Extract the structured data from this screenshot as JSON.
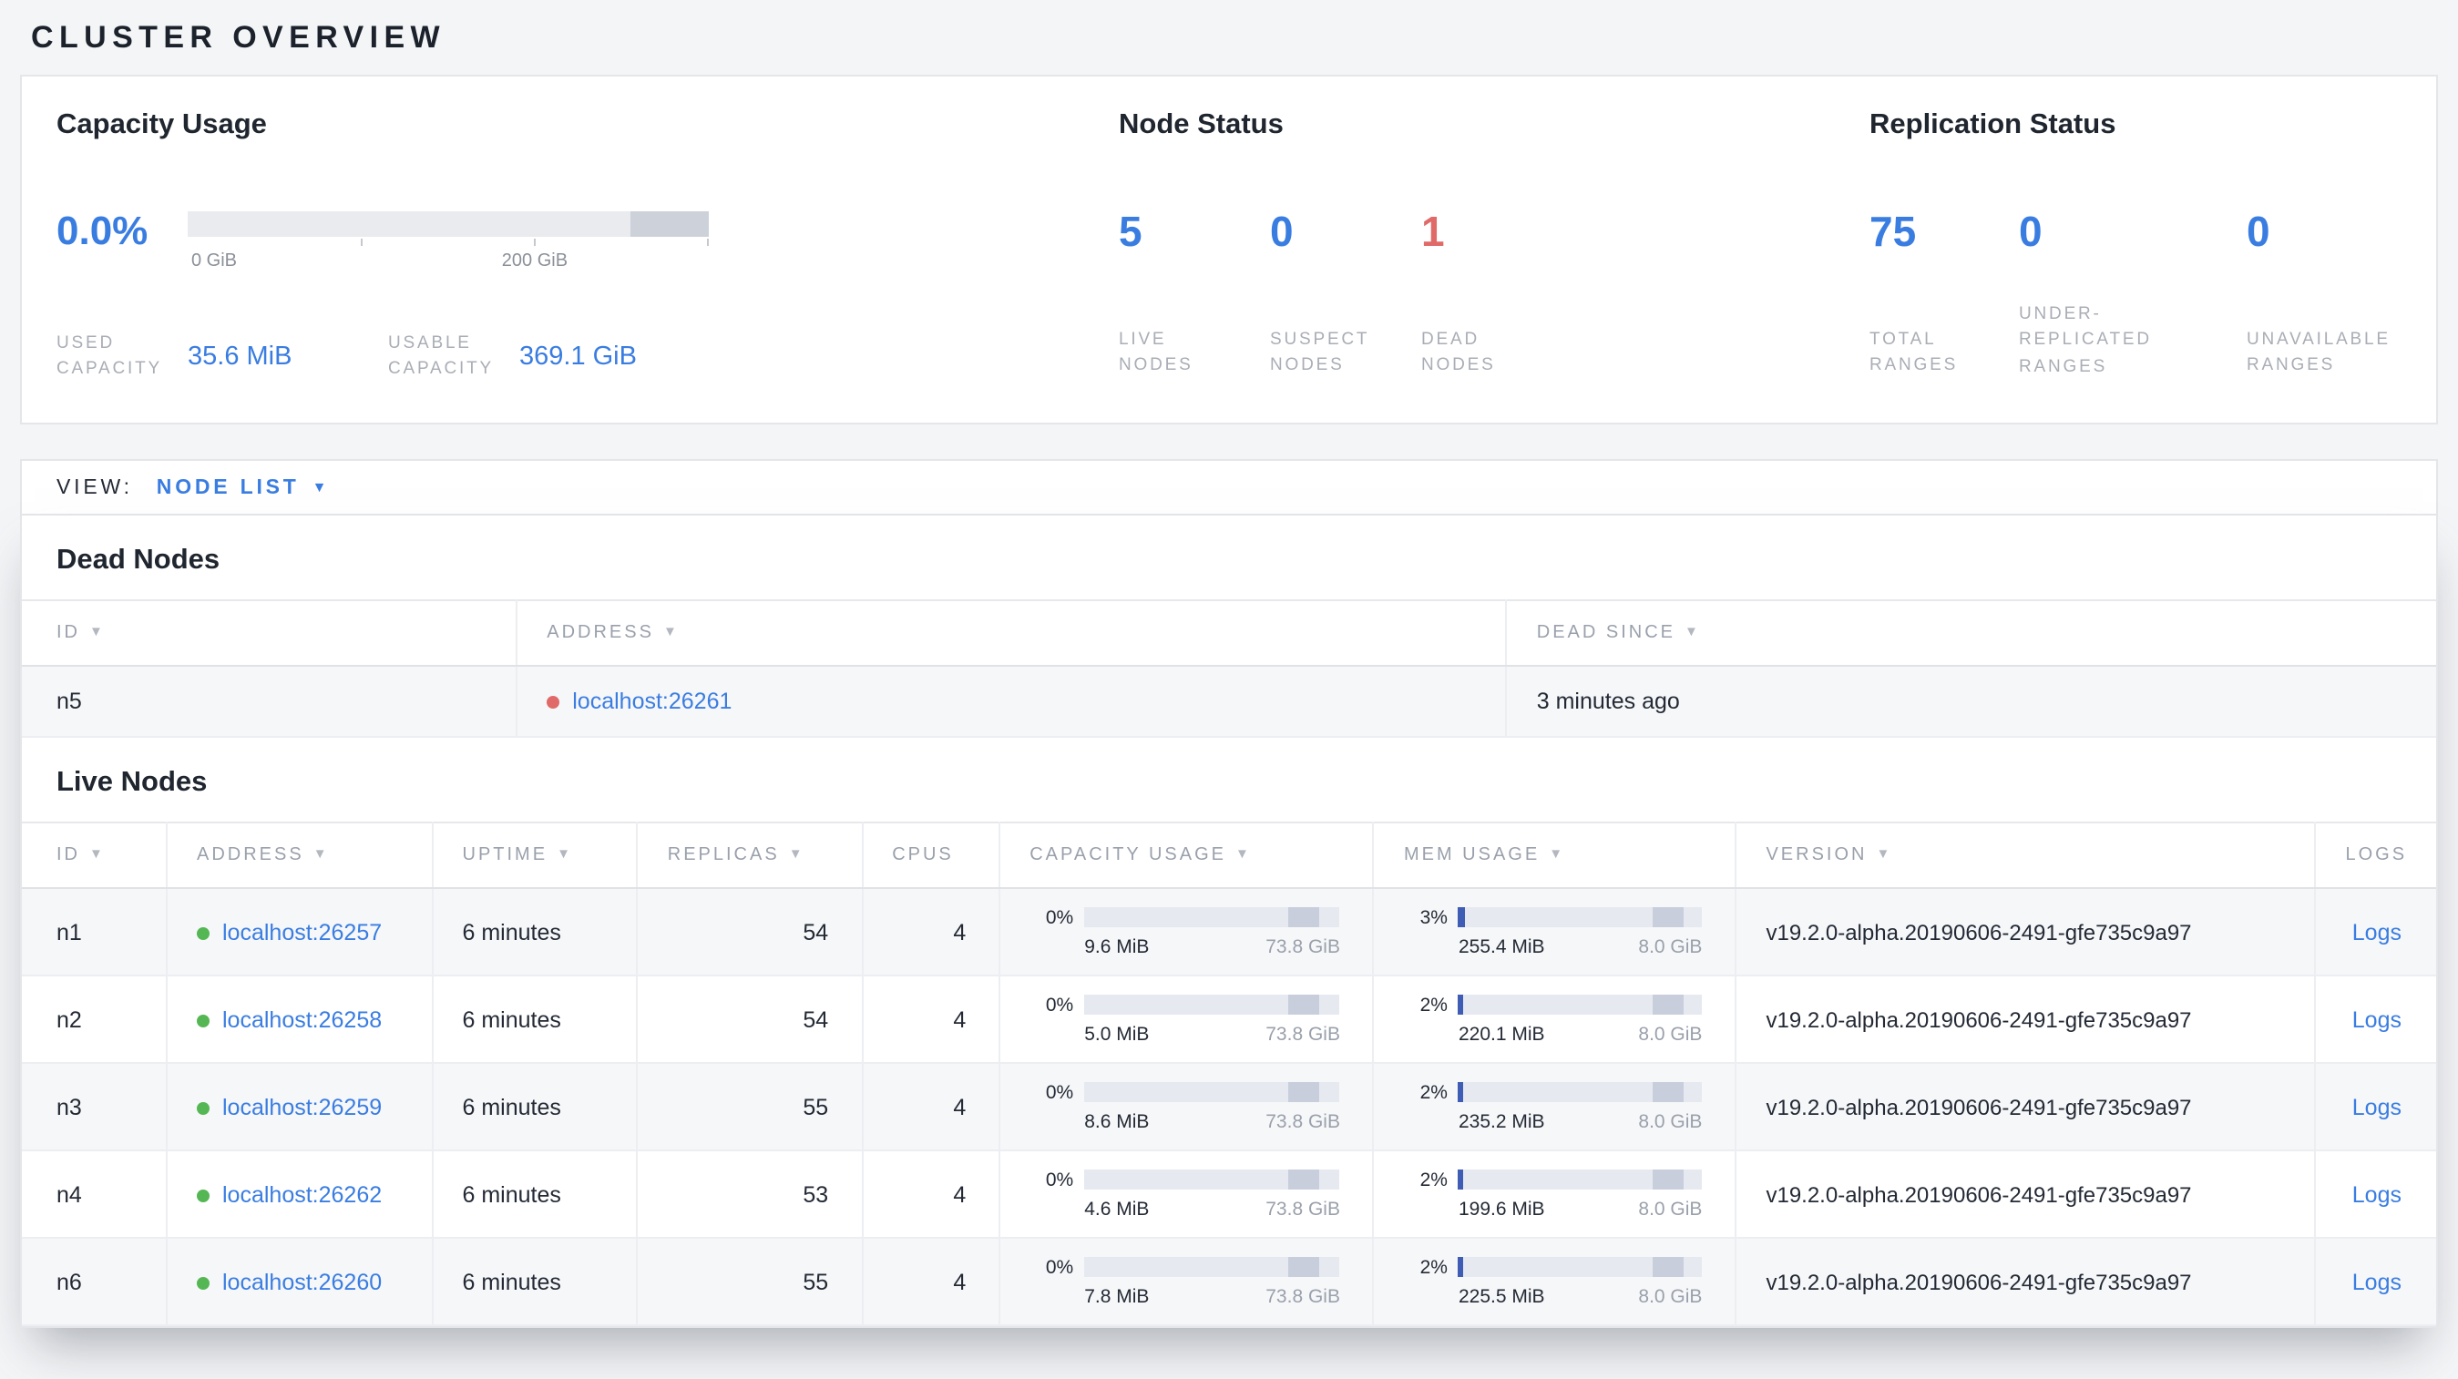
{
  "page": {
    "title": "CLUSTER OVERVIEW"
  },
  "colors": {
    "accent_blue": "#3a7de1",
    "danger_red": "#e06a68",
    "live_green": "#55b754",
    "mem_bar_blue": "#3f5db4"
  },
  "icons": {
    "sort_arrow": "▼",
    "dropdown_caret": "▼"
  },
  "summary": {
    "capacity": {
      "title": "Capacity Usage",
      "percent": "0.0%",
      "axis": {
        "start": "0 GiB",
        "mid": "200 GiB"
      },
      "stats": [
        {
          "label": "USED\nCAPACITY",
          "value": "35.6 MiB"
        },
        {
          "label": "USABLE\nCAPACITY",
          "value": "369.1 GiB"
        }
      ]
    },
    "node_status": {
      "title": "Node Status",
      "stats": [
        {
          "value": "5",
          "label": "LIVE\nNODES"
        },
        {
          "value": "0",
          "label": "SUSPECT\nNODES"
        },
        {
          "value": "1",
          "label": "DEAD\nNODES"
        }
      ]
    },
    "replication": {
      "title": "Replication Status",
      "stats": [
        {
          "value": "75",
          "label": "TOTAL\nRANGES"
        },
        {
          "value": "0",
          "label": "UNDER-\nREPLICATED\nRANGES"
        },
        {
          "value": "0",
          "label": "UNAVAILABLE\nRANGES"
        }
      ]
    }
  },
  "view_bar": {
    "label": "VIEW:",
    "selected": "NODE LIST"
  },
  "dead_nodes": {
    "title": "Dead Nodes",
    "columns": [
      "ID",
      "ADDRESS",
      "DEAD SINCE"
    ],
    "rows": [
      {
        "id": "n5",
        "address": "localhost:26261",
        "dead_since": "3 minutes ago"
      }
    ]
  },
  "live_nodes": {
    "title": "Live Nodes",
    "columns": [
      "ID",
      "ADDRESS",
      "UPTIME",
      "REPLICAS",
      "CPUS",
      "CAPACITY USAGE",
      "MEM USAGE",
      "VERSION",
      "LOGS"
    ],
    "rows": [
      {
        "id": "n1",
        "address": "localhost:26257",
        "uptime": "6 minutes",
        "replicas": "54",
        "cpus": "4",
        "capacity": {
          "percent": "0%",
          "pct": 0,
          "used": "9.6 MiB",
          "total": "73.8 GiB"
        },
        "memory": {
          "percent": "3%",
          "pct": 3,
          "used": "255.4 MiB",
          "total": "8.0 GiB"
        },
        "version": "v19.2.0-alpha.20190606-2491-gfe735c9a97",
        "logs_label": "Logs"
      },
      {
        "id": "n2",
        "address": "localhost:26258",
        "uptime": "6 minutes",
        "replicas": "54",
        "cpus": "4",
        "capacity": {
          "percent": "0%",
          "pct": 0,
          "used": "5.0 MiB",
          "total": "73.8 GiB"
        },
        "memory": {
          "percent": "2%",
          "pct": 2,
          "used": "220.1 MiB",
          "total": "8.0 GiB"
        },
        "version": "v19.2.0-alpha.20190606-2491-gfe735c9a97",
        "logs_label": "Logs"
      },
      {
        "id": "n3",
        "address": "localhost:26259",
        "uptime": "6 minutes",
        "replicas": "55",
        "cpus": "4",
        "capacity": {
          "percent": "0%",
          "pct": 0,
          "used": "8.6 MiB",
          "total": "73.8 GiB"
        },
        "memory": {
          "percent": "2%",
          "pct": 2,
          "used": "235.2 MiB",
          "total": "8.0 GiB"
        },
        "version": "v19.2.0-alpha.20190606-2491-gfe735c9a97",
        "logs_label": "Logs"
      },
      {
        "id": "n4",
        "address": "localhost:26262",
        "uptime": "6 minutes",
        "replicas": "53",
        "cpus": "4",
        "capacity": {
          "percent": "0%",
          "pct": 0,
          "used": "4.6 MiB",
          "total": "73.8 GiB"
        },
        "memory": {
          "percent": "2%",
          "pct": 2,
          "used": "199.6 MiB",
          "total": "8.0 GiB"
        },
        "version": "v19.2.0-alpha.20190606-2491-gfe735c9a97",
        "logs_label": "Logs"
      },
      {
        "id": "n6",
        "address": "localhost:26260",
        "uptime": "6 minutes",
        "replicas": "55",
        "cpus": "4",
        "capacity": {
          "percent": "0%",
          "pct": 0,
          "used": "7.8 MiB",
          "total": "73.8 GiB"
        },
        "memory": {
          "percent": "2%",
          "pct": 2,
          "used": "225.5 MiB",
          "total": "8.0 GiB"
        },
        "version": "v19.2.0-alpha.20190606-2491-gfe735c9a97",
        "logs_label": "Logs"
      }
    ]
  }
}
